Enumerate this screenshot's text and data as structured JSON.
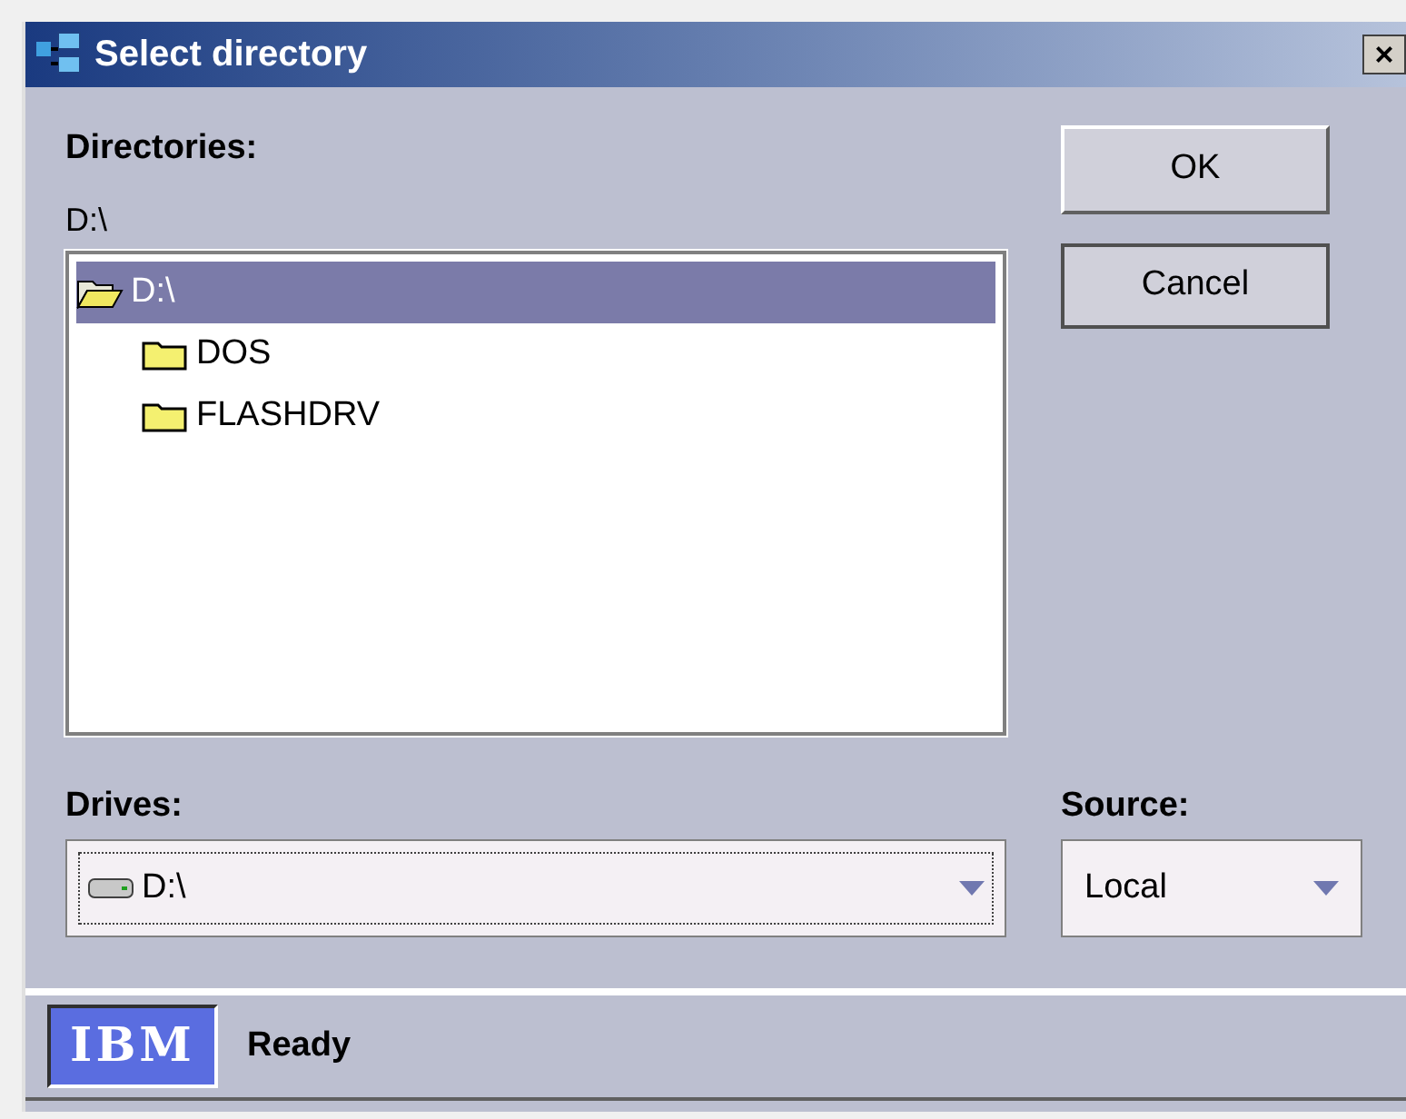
{
  "window": {
    "title": "Select directory",
    "close": "×"
  },
  "directories": {
    "label": "Directories:",
    "path": "D:\\",
    "tree": [
      {
        "label": "D:\\",
        "selected": true,
        "expanded": true,
        "children": [
          {
            "label": "DOS",
            "selected": false,
            "expanded": false
          },
          {
            "label": "FLASHDRV",
            "selected": false,
            "expanded": false
          }
        ]
      }
    ]
  },
  "buttons": [
    "OK",
    "Cancel"
  ],
  "drives": {
    "label": "Drives:",
    "value": "D:\\"
  },
  "source": {
    "label": "Source:",
    "value": "Local"
  },
  "status_bar": {
    "logo": "IBM",
    "text": "Ready"
  }
}
